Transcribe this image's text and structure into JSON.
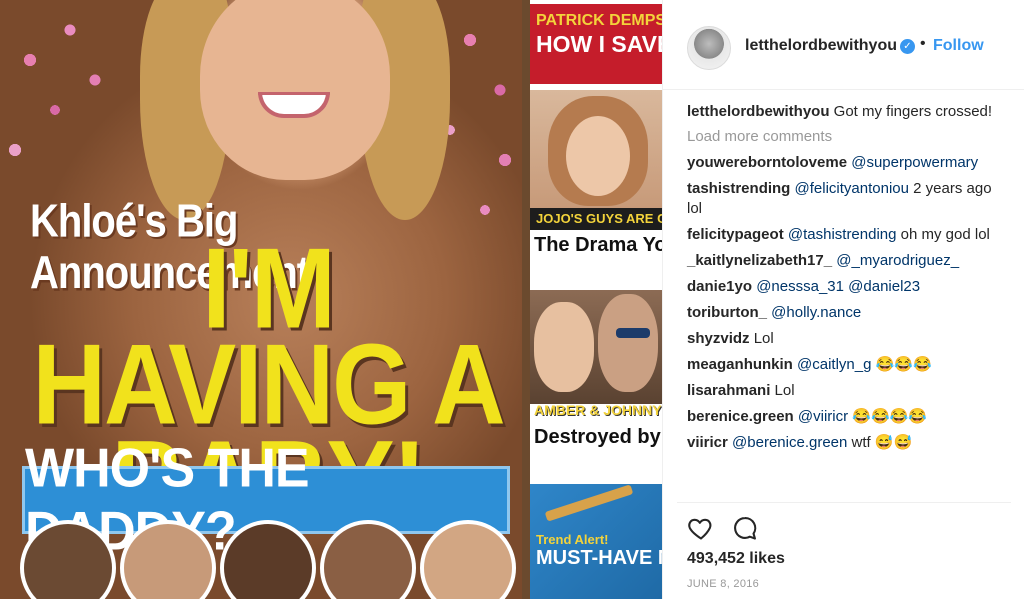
{
  "post": {
    "username": "letthelordbewithyou",
    "follow_label": "Follow",
    "separator": "•",
    "caption_user": "letthelordbewithyou",
    "caption_text": " Got my fingers crossed!",
    "load_more": "Load more comments",
    "likes": "493,452 likes",
    "date": "JUNE 8, 2016"
  },
  "comments": [
    {
      "user": "youwereborntoloveme",
      "mention": "@superpowermary",
      "text": ""
    },
    {
      "user": "tashistrending",
      "mention": "@felicityantoniou",
      "text": " 2 years ago lol"
    },
    {
      "user": "felicitypageot",
      "mention": "@tashistrending",
      "text": " oh my god lol"
    },
    {
      "user": "_kaitlynelizabeth17_",
      "mention": "@_myarodriguez_",
      "text": ""
    },
    {
      "user": "danie1yo",
      "mention": "@nesssa_31 @daniel23",
      "text": ""
    },
    {
      "user": "toriburton_",
      "mention": "@holly.nance",
      "text": ""
    },
    {
      "user": "shyzvidz",
      "mention": "",
      "text": " Lol"
    },
    {
      "user": "meaganhunkin",
      "mention": "@caitlyn_g",
      "text": " 😂😂😂"
    },
    {
      "user": "lisarahmani",
      "mention": "",
      "text": " Lol"
    },
    {
      "user": "berenice.green",
      "mention": "@viiricr",
      "text": " 😂😂😂😂"
    },
    {
      "user": "viiricr",
      "mention": "@berenice.green",
      "text": " wtf 😅😅"
    }
  ],
  "magazine": {
    "headline_top": "Khloé's Big Announcement",
    "headline_main": "I'M HAVING A BABY!",
    "banner": "WHO'S THE DADDY?",
    "side_a_line1": "PATRICK DEMPSEY",
    "side_a_line2": "HOW I SAVED MY MARRIAGE",
    "side_b_tag": "JOJO'S GUYS ARE CRAZ",
    "side_b_title": "The Drama You Won't See on TV",
    "side_c_tag": "AMBER & JOHNNY",
    "side_c_title": "Destroyed by Greed & Drugs",
    "side_d_line1": "Trend Alert!",
    "side_d_line2": "MUST-HAVE METALLIC"
  },
  "colors": {
    "link_blue": "#3897f0",
    "mention_blue": "#003569",
    "muted": "#999999",
    "headline_yellow": "#f1e21c",
    "banner_blue": "#2d8fd6"
  },
  "icons": {
    "verified": "verified-badge-icon",
    "like": "heart-icon",
    "comment": "comment-bubble-icon"
  }
}
